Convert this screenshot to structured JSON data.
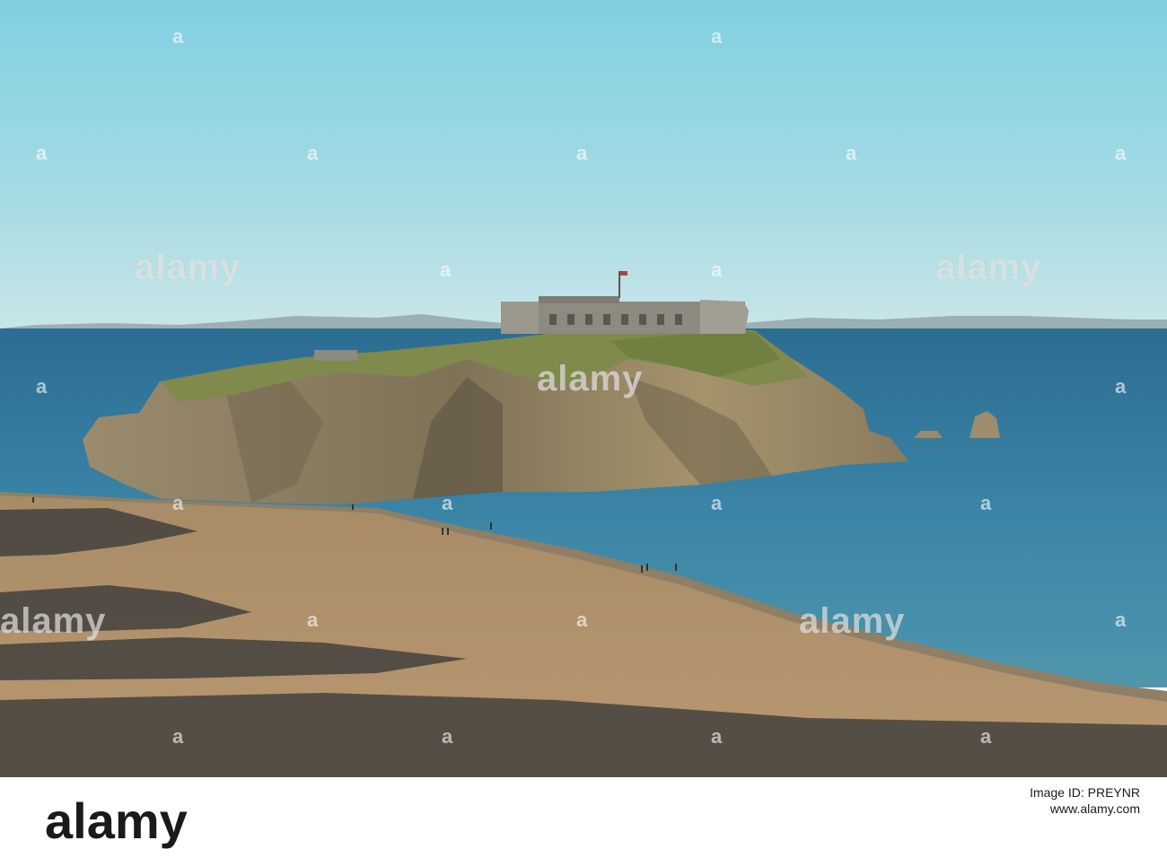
{
  "watermark": {
    "big_text": "alamy",
    "small_text": "a"
  },
  "footer": {
    "brand": "alamy",
    "image_id_label": "Image ID: PREYNR",
    "site": "www.alamy.com"
  }
}
